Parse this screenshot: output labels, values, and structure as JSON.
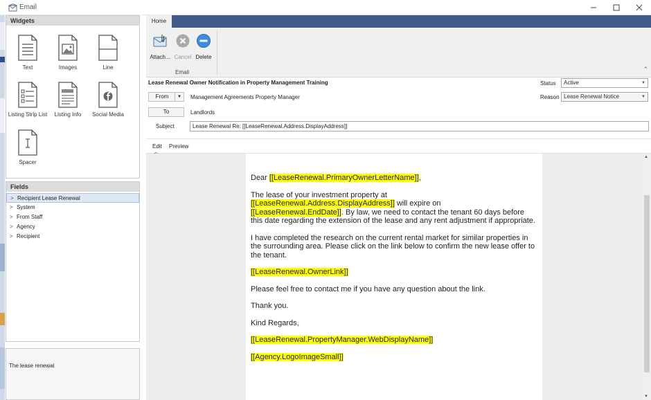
{
  "window": {
    "title": "Email"
  },
  "widgets_panel": {
    "header": "Widgets",
    "items": [
      {
        "label": "Text",
        "icon": "text-document-icon"
      },
      {
        "label": "Images",
        "icon": "image-document-icon"
      },
      {
        "label": "Line",
        "icon": "line-document-icon"
      },
      {
        "label": "Listing Strip List",
        "icon": "listing-strip-list-icon"
      },
      {
        "label": "Listing Info",
        "icon": "listing-info-icon"
      },
      {
        "label": "Social Media",
        "icon": "social-media-icon"
      },
      {
        "label": "Spacer",
        "icon": "spacer-icon"
      }
    ]
  },
  "fields_panel": {
    "header": "Fields",
    "items": [
      {
        "label": "Recipient Lease Renewal",
        "selected": true
      },
      {
        "label": "System"
      },
      {
        "label": "From Staff"
      },
      {
        "label": "Agency"
      },
      {
        "label": "Recipient"
      }
    ]
  },
  "description_panel": {
    "text": "The lease renewal"
  },
  "ribbon": {
    "tab": "Home",
    "buttons": {
      "attach": "Attach...",
      "cancel": "Cancel",
      "delete": "Delete"
    },
    "group_label": "Email"
  },
  "email": {
    "heading": "Lease Renewal Owner Notification in Property Management Training",
    "from_button": "From",
    "from_value": "Management Agreements Property Manager",
    "to_button": "To",
    "to_value": "Landlords",
    "subject_label": "Subject",
    "subject_value": "Lease Renewal Re: [[LeaseRenewal.Address.DisplayAddress]]",
    "status_label": "Status",
    "status_value": "Active",
    "reason_label": "Reason",
    "reason_value": "Lease Renewal Notice"
  },
  "editor": {
    "tabs": {
      "edit": "Edit",
      "preview": "Preview"
    },
    "letter": {
      "greeting": "Dear",
      "primary_owner": "[[LeaseRenewal.PrimaryOwnerLetterName]]",
      "greeting_end": ",",
      "p1_a": "The lease of your investment property at",
      "address": "[[LeaseRenewal.Address.DisplayAddress]]",
      "p1_b": " will expire on",
      "end_date": "[[LeaseRenewal.EndDate]]",
      "p1_c": ". By law, we need to contact the tenant 60 days before this date regarding the extension of the lease and any rent adjustment if appropriate.",
      "p2": "I have completed the research on the current rental market for similar properties in the surrounding area. Please click on the link below to confirm the new lease offer to the tenant.",
      "owner_link": "[[LeaseRenewal.OwnerLink]]",
      "p3": "Please feel free to contact me if you have any question about the link.",
      "thanks": "Thank you.",
      "regards": "Kind Regards,",
      "pm_name": "[[LeaseRenewal.PropertyManager.WebDisplayName]]",
      "logo": "[[Agency.LogoImageSmall]]"
    }
  },
  "colors": {
    "ribbon_bar": "#3f5b8a",
    "highlight": "#ffff00",
    "selection": "#dde7f6",
    "delete_icon": "#3c8ddc"
  }
}
